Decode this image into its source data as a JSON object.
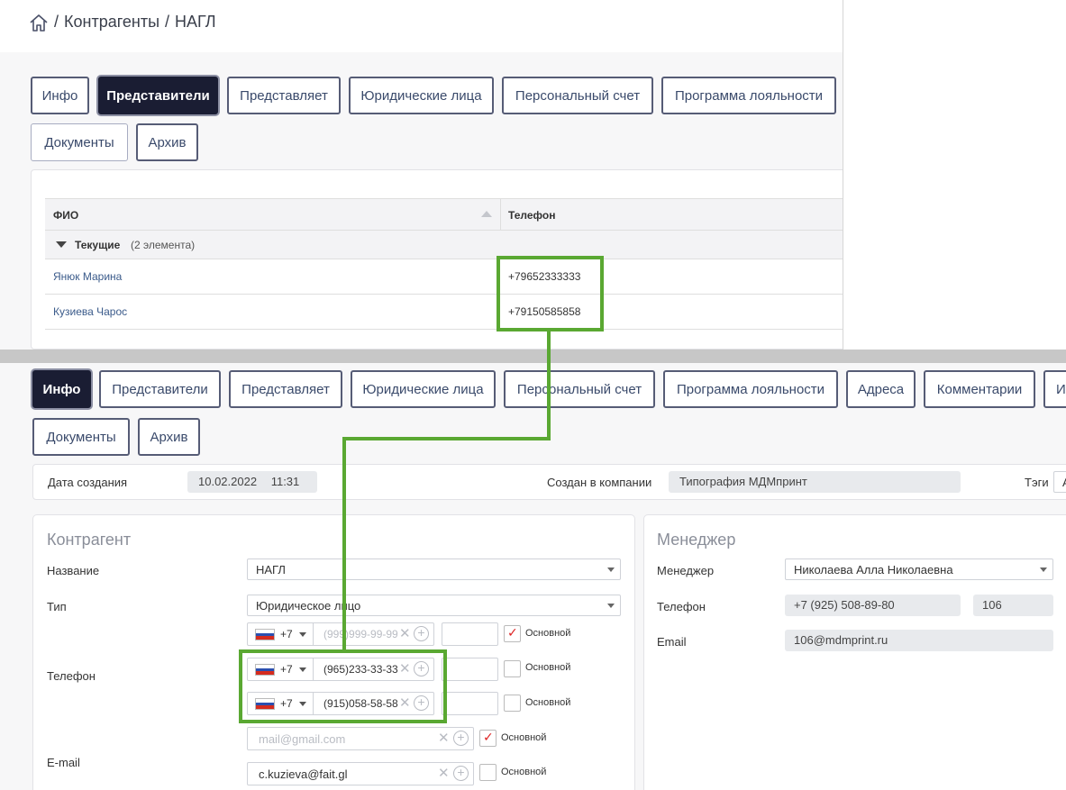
{
  "top": {
    "breadcrumb": [
      "Контрагенты",
      "НАГЛ"
    ],
    "tabs": [
      "Инфо",
      "Представители",
      "Представляет",
      "Юридические лица",
      "Персональный счет",
      "Программа лояльности",
      "Документы",
      "Архив"
    ],
    "grid": {
      "col_name": "ФИО",
      "col_phone": "Телефон",
      "group_name": "Текущие",
      "group_count": "(2 элемента)",
      "rows": [
        {
          "name": "Янюк Марина",
          "phone": "+79652333333"
        },
        {
          "name": "Кузиева Чарос",
          "phone": "+79150585858"
        }
      ]
    }
  },
  "bottom": {
    "tabs": [
      "Инфо",
      "Представители",
      "Представляет",
      "Юридические лица",
      "Персональный счет",
      "Программа лояльности",
      "Адреса",
      "Комментарии",
      "И",
      "Документы",
      "Архив"
    ],
    "meta": {
      "created_label": "Дата создания",
      "created_date": "10.02.2022",
      "created_time": "11:31",
      "company_label": "Создан в компании",
      "company_value": "Типография МДМпринт",
      "tags_label": "Тэги",
      "tags_value": "А"
    },
    "contractor": {
      "title": "Контрагент",
      "name_label": "Название",
      "name_value": "НАГЛ",
      "type_label": "Тип",
      "type_value": "Юридическое лицо",
      "phone_label": "Телефон",
      "phones": [
        {
          "code": "+7",
          "number": "(999)999-99-99",
          "placeholder": true,
          "main": true
        },
        {
          "code": "+7",
          "number": "(965)233-33-33",
          "placeholder": false,
          "main": false
        },
        {
          "code": "+7",
          "number": "(915)058-58-58",
          "placeholder": false,
          "main": false
        }
      ],
      "main_label": "Основной",
      "email_label": "E-mail",
      "emails": [
        {
          "value": "mail@gmail.com",
          "placeholder": true,
          "main": true
        },
        {
          "value": "c.kuzieva@fait.gl",
          "placeholder": false,
          "main": false
        }
      ]
    },
    "manager": {
      "title": "Менеджер",
      "manager_label": "Менеджер",
      "manager_value": "Николаева Алла Николаевна",
      "phone_label": "Телефон",
      "phone_value": "+7 (925) 508-89-80",
      "ext_value": "106",
      "email_label": "Email",
      "email_value": "106@mdmprint.ru"
    }
  },
  "colors": {
    "active_tab": "#1a1d33",
    "highlight": "#5aa832",
    "flag_white": "#ffffff",
    "flag_blue": "#2a4fb0",
    "flag_red": "#d52b1e"
  }
}
